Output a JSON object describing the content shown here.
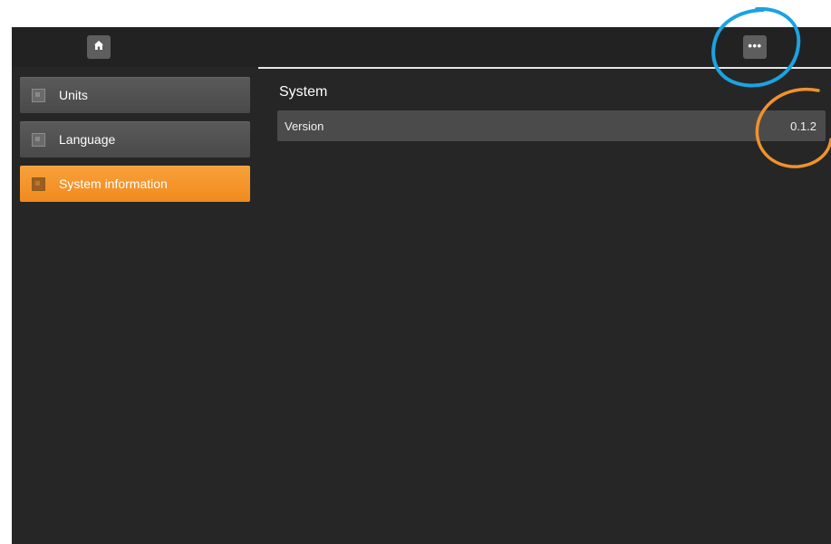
{
  "header": {
    "home_icon": "home-icon",
    "more_icon": "more-icon",
    "more_glyph": "•••"
  },
  "sidebar": {
    "items": [
      {
        "label": "Units",
        "icon": "settings-item-icon",
        "active": false
      },
      {
        "label": "Language",
        "icon": "settings-item-icon",
        "active": false
      },
      {
        "label": "System information",
        "icon": "settings-item-icon",
        "active": true
      }
    ]
  },
  "main": {
    "section_title": "System",
    "rows": [
      {
        "label": "Version",
        "value": "0.1.2"
      }
    ]
  },
  "colors": {
    "accent": "#f39425",
    "background": "#262626",
    "annotation_blue": "#1aa3e0",
    "annotation_orange": "#f0922e"
  }
}
